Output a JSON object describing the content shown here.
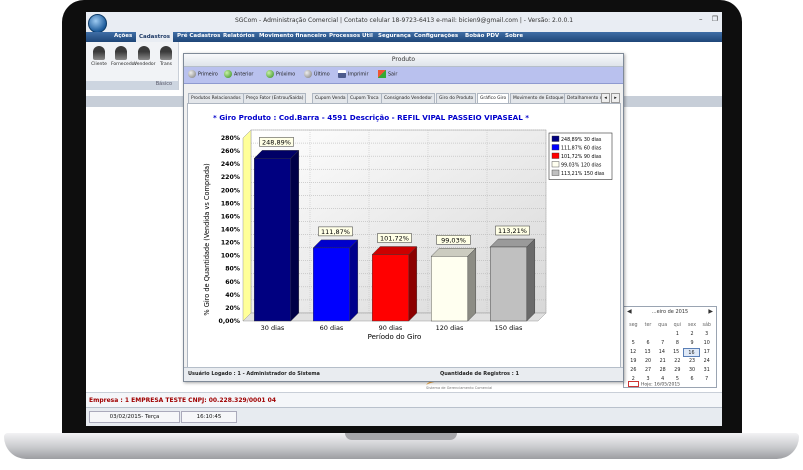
{
  "window": {
    "title": "SGCom - Administração Comercial | Contato celular 18-9723-6413 e-mail: bicien9@gmail.com | - Versão: 2.0.0.1",
    "minimize_glyph": "–",
    "restore_glyph": "❐"
  },
  "menu": {
    "items": [
      "Ações",
      "Cadastros",
      "Pré Cadastros",
      "Relatórios",
      "Movimento financeiro",
      "Processos",
      "Util",
      "Segurança",
      "Configurações",
      "Bobão PDV",
      "Sobre"
    ],
    "active": "Cadastros"
  },
  "ribbon": {
    "buttons": [
      "Cliente",
      "Fornecedor",
      "Vendedor",
      "Trans"
    ],
    "caption": "Básico"
  },
  "modal": {
    "title": "Produto",
    "toolbar": [
      "Primeiro",
      "Anterior",
      "Próximo",
      "Último",
      "Imprimir",
      "Sair"
    ],
    "tabs": [
      "Produtos Relacionados",
      "Preço Fator (Entrou/Saída)",
      "Cupom Venda",
      "Cupom Troca",
      "Consignado Vendedor",
      "Giro do Produto",
      "Gráfico Giro",
      "Movimento de Estoque",
      "Detalhamento do"
    ],
    "active_tab": "Gráfico Giro",
    "status_user": "Usuário Logado : 1 - Administrador do Sistema",
    "status_records": "Quantidade de Registros : 1"
  },
  "chart_data": {
    "type": "bar",
    "title": "* Giro Produto : Cod.Barra - 4591 Descrição - REFIL VIPAL PASSEIO VIPASEAL *",
    "xlabel": "Período do Giro",
    "ylabel": "% Giro de Quantidade (Vendida vs Comprada)",
    "categories": [
      "30 dias",
      "60 dias",
      "90 dias",
      "120 dias",
      "150 dias"
    ],
    "values": [
      248.89,
      111.87,
      101.72,
      99.03,
      113.21
    ],
    "value_labels": [
      "248,89%",
      "111,87%",
      "101,72%",
      "99,03%",
      "113,21%"
    ],
    "colors": [
      "#000080",
      "#0000ff",
      "#ff0000",
      "#fffff0",
      "#c0c0c0"
    ],
    "ylim": [
      0,
      280
    ],
    "yticks": [
      0,
      20,
      40,
      60,
      80,
      100,
      120,
      140,
      160,
      180,
      200,
      220,
      240,
      260,
      280
    ],
    "ytick_labels": [
      "0,00%",
      "20%",
      "40%",
      "60%",
      "80%",
      "100%",
      "120%",
      "140%",
      "160%",
      "180%",
      "200%",
      "220%",
      "240%",
      "260%",
      "280%"
    ],
    "legend": [
      "248,89% 30 dias",
      "111,87% 60 dias",
      "101,72% 90 dias",
      "99,03% 120 dias",
      "113,21% 150 dias"
    ],
    "legend_position": "top-right",
    "grid": true,
    "style": "3d"
  },
  "status": {
    "empresa": "Empresa : 1   EMPRESA TESTE  CNPJ: 00.228.329/0001 04",
    "date": "03/02/2015- Terça",
    "time": "16:10:45"
  },
  "calendar": {
    "title": "...eiro de 2015",
    "prev": "◀",
    "next": "▶",
    "days": [
      "seg",
      "ter",
      "qua",
      "qui",
      "sex",
      "sáb"
    ],
    "weeks": [
      [
        "",
        "",
        "",
        "1",
        "2",
        "3"
      ],
      [
        "5",
        "6",
        "7",
        "8",
        "9",
        "10"
      ],
      [
        "12",
        "13",
        "14",
        "15",
        "16",
        "17"
      ],
      [
        "19",
        "20",
        "21",
        "22",
        "23",
        "24"
      ],
      [
        "26",
        "27",
        "28",
        "29",
        "30",
        "31"
      ],
      [
        "2",
        "3",
        "4",
        "5",
        "6",
        "7"
      ]
    ],
    "selected": "16",
    "today_label": "Hoje: 16/05/2015"
  },
  "footer_logo": {
    "text": "comercial",
    "subtitle": "Sistema de Gerenciamento Comercial"
  }
}
